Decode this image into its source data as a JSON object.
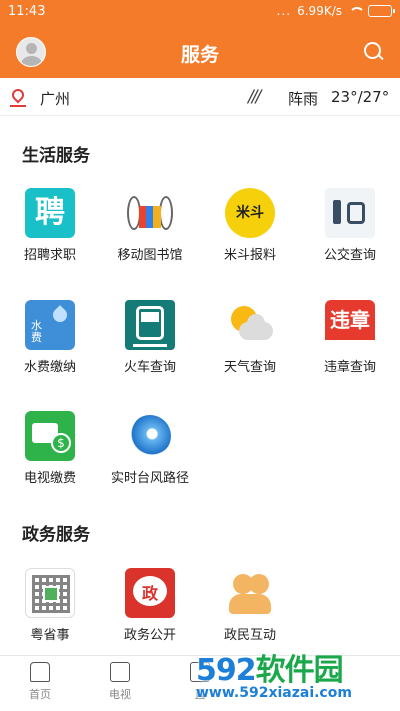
{
  "status_bar": {
    "time": "11:43",
    "dots": "...",
    "speed": "6.99K/s"
  },
  "header": {
    "title": "服务"
  },
  "location": {
    "city": "广州",
    "weather_icon": "///",
    "weather": "阵雨",
    "temperature": "23°/27°"
  },
  "sections": {
    "life": {
      "title": "生活服务",
      "items": [
        {
          "label": "招聘求职",
          "icon": "zhaopin-icon",
          "glyph": "聘"
        },
        {
          "label": "移动图书馆",
          "icon": "library-icon"
        },
        {
          "label": "米斗报料",
          "icon": "midou-icon",
          "glyph": "米斗"
        },
        {
          "label": "公交查询",
          "icon": "bus-icon"
        },
        {
          "label": "水费缴纳",
          "icon": "water-fee-icon",
          "glyph": "水\n费"
        },
        {
          "label": "火车查询",
          "icon": "train-icon"
        },
        {
          "label": "天气查询",
          "icon": "weather-icon"
        },
        {
          "label": "违章查询",
          "icon": "violation-icon",
          "glyph": "违章"
        },
        {
          "label": "电视缴费",
          "icon": "tv-fee-icon",
          "glyph": "$"
        },
        {
          "label": "实时台风路径",
          "icon": "typhoon-icon"
        }
      ]
    },
    "gov": {
      "title": "政务服务",
      "items": [
        {
          "label": "粤省事",
          "icon": "qr-code-icon"
        },
        {
          "label": "政务公开",
          "icon": "gov-open-icon",
          "glyph": "政"
        },
        {
          "label": "政民互动",
          "icon": "people-icon"
        }
      ]
    }
  },
  "bottom_nav": [
    {
      "label": "首页",
      "icon": "home-icon"
    },
    {
      "label": "电视",
      "icon": "tv-icon"
    },
    {
      "label": "直",
      "icon": "play-icon"
    }
  ],
  "watermark": {
    "brand_num": "592",
    "brand_text": "软件园",
    "url": "www.592xiazai.com"
  },
  "colors": {
    "accent": "#f47b2a"
  }
}
